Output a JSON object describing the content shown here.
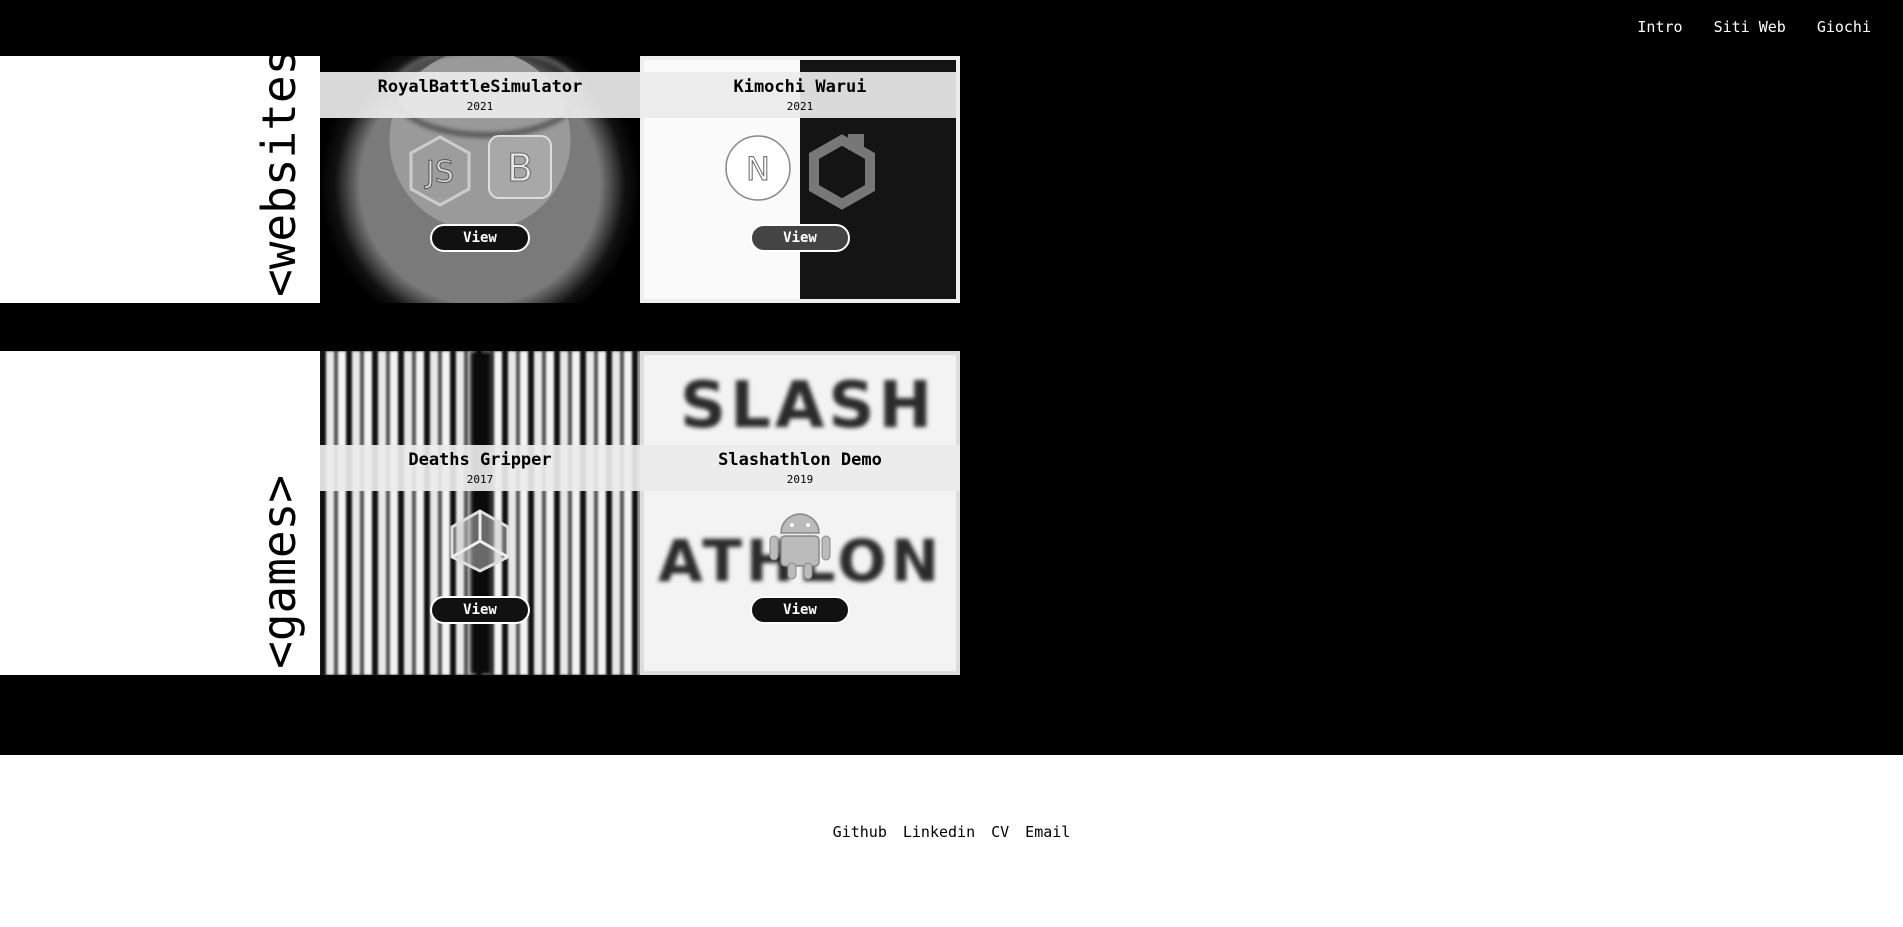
{
  "nav": {
    "items": [
      {
        "label": "Intro"
      },
      {
        "label": "Siti Web"
      },
      {
        "label": "Giochi"
      }
    ]
  },
  "sections": {
    "websites": {
      "label": "<websites>",
      "cards": [
        {
          "title": "RoyalBattleSimulator",
          "year": "2021",
          "view_label": "View",
          "icons": [
            "nodejs-icon",
            "bootstrap-icon"
          ]
        },
        {
          "title": "Kimochi Warui",
          "year": "2021",
          "view_label": "View",
          "icons": [
            "nextjs-icon",
            "uikit-icon"
          ]
        }
      ]
    },
    "games": {
      "label": "<games>",
      "cards": [
        {
          "title": "Deaths Gripper",
          "year": "2017",
          "view_label": "View",
          "icons": [
            "unity-icon"
          ]
        },
        {
          "title": "Slashathlon Demo",
          "year": "2019",
          "view_label": "View",
          "icons": [
            "android-icon"
          ],
          "bg_text": [
            "SLASH",
            "ATHLON"
          ]
        }
      ]
    }
  },
  "footer": {
    "links": [
      {
        "label": "Github"
      },
      {
        "label": "Linkedin"
      },
      {
        "label": "CV"
      },
      {
        "label": "Email"
      }
    ]
  }
}
